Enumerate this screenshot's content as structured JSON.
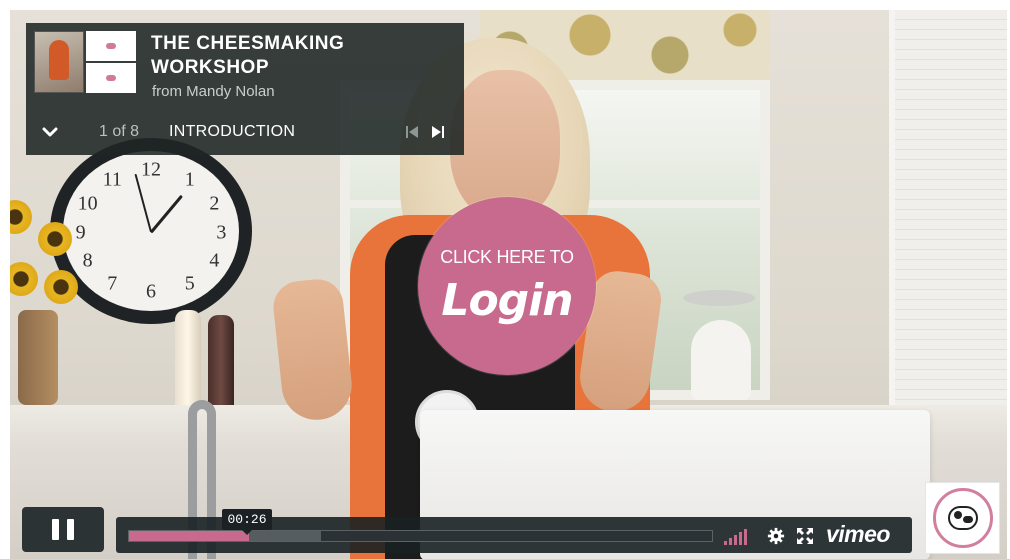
{
  "video": {
    "title": "THE CHEESMAKING WORKSHOP",
    "author_prefix": "from",
    "author": "Mandy Nolan",
    "chapter_count": "1 of 8",
    "chapter_title": "INTRODUCTION"
  },
  "login_overlay": {
    "top_text": "CLICK HERE TO",
    "main_text": "Login"
  },
  "player": {
    "current_time": "00:26",
    "played_fraction": 0.205,
    "loaded_fraction": 0.33,
    "brand_label": "vimeo",
    "accent_color": "#c86a8d"
  },
  "icons": {
    "collapse": "chevron-down-icon",
    "prev": "skip-previous-icon",
    "next": "skip-next-icon",
    "pause": "pause-icon",
    "volume": "volume-bars-icon",
    "settings": "gear-icon",
    "fullscreen": "fullscreen-icon"
  }
}
